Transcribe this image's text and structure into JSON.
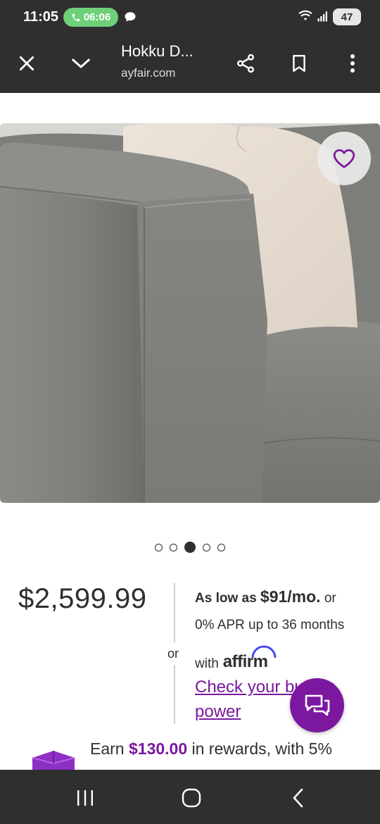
{
  "status_bar": {
    "time": "11:05",
    "call_duration": "06:06",
    "battery": "47",
    "icons": [
      "phone-icon",
      "chat-bubble-icon",
      "wifi-icon",
      "signal-icon",
      "battery-icon"
    ]
  },
  "toolbar": {
    "title": "Hokku D...",
    "url": "ayfair.com",
    "icons": [
      "close-icon",
      "chevron-down-icon",
      "share-icon",
      "bookmark-icon",
      "more-vert-icon"
    ]
  },
  "product": {
    "image_description_icon": "sofa-photo",
    "carousel": {
      "count": 5,
      "active_index": 2
    },
    "price": "$2,599.99"
  },
  "financing": {
    "prefix": "As low as ",
    "monthly": "$91/mo.",
    "suffix": " or",
    "apr_line": "0% APR up to 36 months",
    "with_label": "with",
    "provider": "affirm",
    "check_link": "Check your buying power",
    "or_label": "or"
  },
  "rewards": {
    "prefix": "Earn ",
    "amount": "$130.00",
    "suffix": " in rewards, with 5%"
  },
  "colors": {
    "brand_purple": "#7b189f",
    "chrome": "#2f2f2f",
    "call_pill": "#6fd07a"
  }
}
